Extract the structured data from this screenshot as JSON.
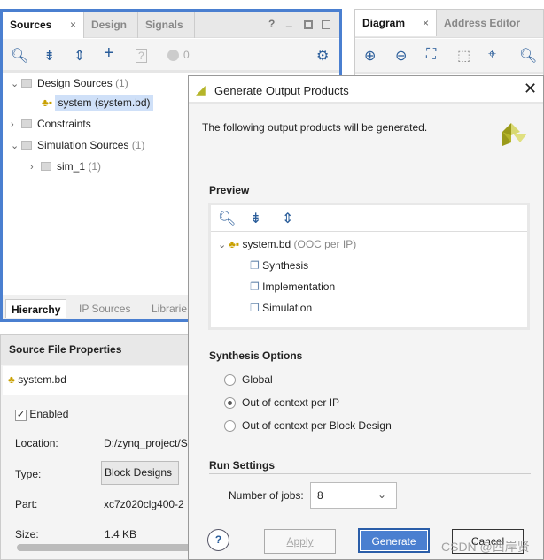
{
  "sources_panel": {
    "tabs": [
      "Sources",
      "Design",
      "Signals"
    ],
    "close": "×",
    "warnings": "0",
    "tree": {
      "design_sources": "Design Sources",
      "design_count": "(1)",
      "system": "system (system.bd)",
      "constraints": "Constraints",
      "sim_sources": "Simulation Sources",
      "sim_count": "(1)",
      "sim_1": "sim_1",
      "sim_1_count": "(1)"
    },
    "bottom_tabs": [
      "Hierarchy",
      "IP Sources",
      "Librarie"
    ]
  },
  "diagram_panel": {
    "tabs": [
      "Diagram",
      "Address Editor"
    ]
  },
  "properties": {
    "title": "Source File Properties",
    "file": "system.bd",
    "enabled_label": "Enabled",
    "location_label": "Location:",
    "location": "D:/zynq_project/Sl",
    "type_label": "Type:",
    "type": "Block Designs",
    "part_label": "Part:",
    "part": "xc7z020clg400-2",
    "size_label": "Size:",
    "size": "1.4 KB"
  },
  "dialog": {
    "title": "Generate Output Products",
    "message": "The following output products will be generated.",
    "preview": "Preview",
    "preview_root": "system.bd",
    "preview_root_note": "(OOC per IP)",
    "preview_children": [
      "Synthesis",
      "Implementation",
      "Simulation"
    ],
    "synthesis_options": "Synthesis Options",
    "radios": [
      {
        "label": "Global",
        "selected": false
      },
      {
        "label": "Out of context per IP",
        "selected": true
      },
      {
        "label": "Out of context per Block Design",
        "selected": false
      }
    ],
    "run_settings": "Run Settings",
    "jobs_label": "Number of jobs:",
    "jobs_value": "8",
    "help": "?",
    "apply": "Apply",
    "generate": "Generate",
    "cancel": "Cancel"
  },
  "watermark": "CSDN @西岸贤",
  "colors": {
    "accent": "#4a7fd0",
    "selection": "#cfe0f8",
    "logo": "#c8c83a"
  }
}
